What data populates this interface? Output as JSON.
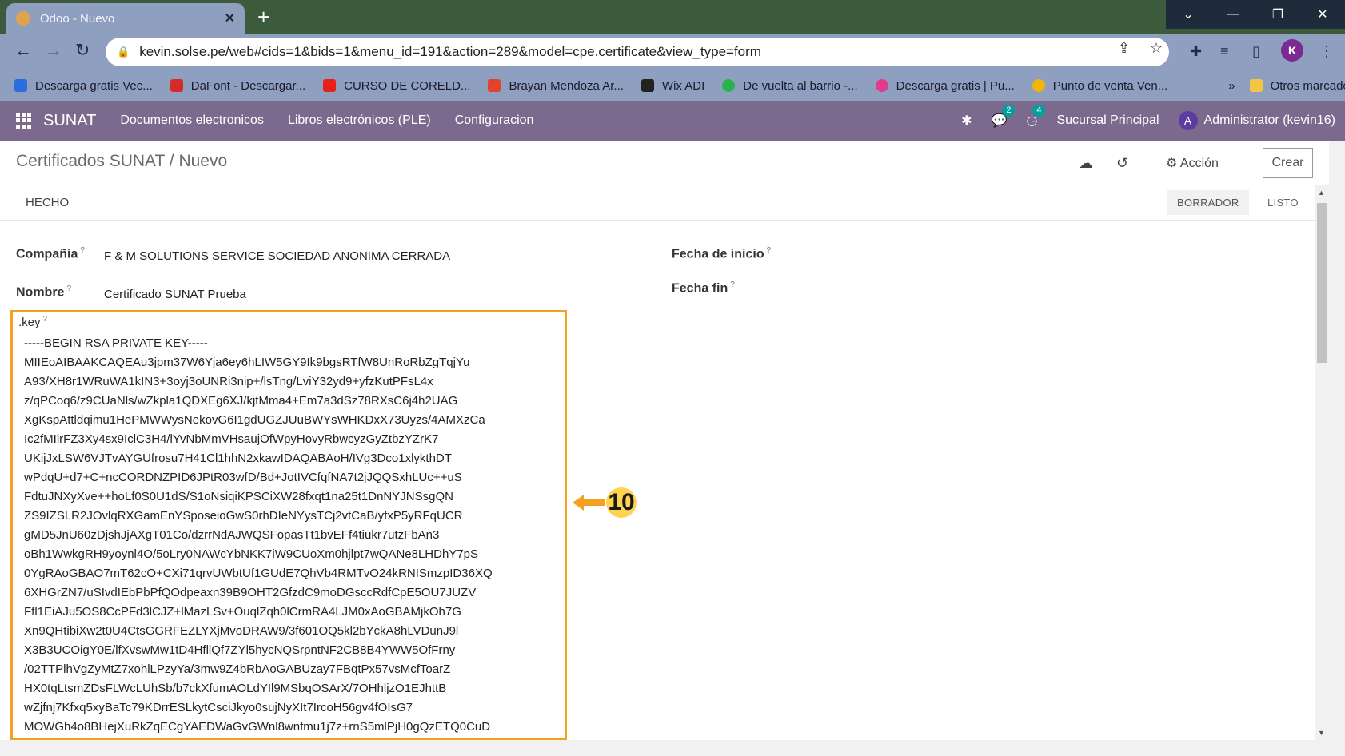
{
  "browser": {
    "tab_title": "Odoo - Nuevo",
    "url": "kevin.solse.pe/web#cids=1&bids=1&menu_id=191&action=289&model=cpe.certificate&view_type=form",
    "profile_initial": "K",
    "bookmarks": [
      {
        "label": "Descarga gratis Vec...",
        "icon": "freepik-icon",
        "color": "#2d6cdf"
      },
      {
        "label": "DaFont - Descargar...",
        "icon": "dafont-icon",
        "color": "#d62b2b"
      },
      {
        "label": "CURSO DE CORELD...",
        "icon": "youtube-icon",
        "color": "#e62117"
      },
      {
        "label": "Brayan Mendoza Ar...",
        "icon": "gitlab-icon",
        "color": "#e2432a"
      },
      {
        "label": "Wix ADI",
        "icon": "wix-icon",
        "color": "#222222"
      },
      {
        "label": "De vuelta al barrio -...",
        "icon": "play-icon",
        "color": "#2bb24c"
      },
      {
        "label": "Descarga gratis | Pu...",
        "icon": "pu-icon",
        "color": "#e23b8c"
      },
      {
        "label": "Punto de venta Ven...",
        "icon": "pos-icon",
        "color": "#f2b705"
      }
    ],
    "bookmarks_more": "»",
    "other_bookmarks": "Otros marcadores"
  },
  "odoo": {
    "brand": "SUNAT",
    "menus": [
      "Documentos electronicos",
      "Libros electrónicos (PLE)",
      "Configuracion"
    ],
    "messages_count": "2",
    "activities_count": "4",
    "branch": "Sucursal Principal",
    "user_initial": "A",
    "user": "Administrator (kevin16)"
  },
  "control_panel": {
    "breadcrumb": "Certificados SUNAT / Nuevo",
    "action_label": "Acción",
    "create_label": "Crear"
  },
  "status": {
    "done_button": "HECHO",
    "stages": [
      "BORRADOR",
      "LISTO"
    ],
    "active_stage": "BORRADOR"
  },
  "form": {
    "company_label": "Compañía",
    "company_value": "F & M SOLUTIONS SERVICE SOCIEDAD ANONIMA CERRADA",
    "name_label": "Nombre",
    "name_value": "Certificado SUNAT Prueba",
    "start_label": "Fecha de inicio",
    "end_label": "Fecha fin",
    "help_mark": "?",
    "key_label": ".key",
    "key_text": "-----BEGIN RSA PRIVATE KEY-----\nMIIEoAIBAAKCAQEAu3jpm37W6Yja6ey6hLIW5GY9Ik9bgsRTfW8UnRoRbZgTqjYu\nA93/XH8r1WRuWA1kIN3+3oyj3oUNRi3nip+/lsTng/LviY32yd9+yfzKutPFsL4x\nz/qPCoq6/z9CUaNls/wZkpla1QDXEg6XJ/kjtMma4+Em7a3dSz78RXsC6j4h2UAG\nXgKspAttldqimu1HePMWWysNekovG6I1gdUGZJUuBWYsWHKDxX73Uyzs/4AMXzCa\nIc2fMIlrFZ3Xy4sx9IclC3H4/lYvNbMmVHsaujOfWpyHovyRbwcyzGyZtbzYZrK7\nUKijJxLSW6VJTvAYGUfrosu7H41Cl1hhN2xkawIDAQABAoH/IVg3Dco1xlykthDT\nwPdqU+d7+C+ncCORDNZPID6JPtR03wfD/Bd+JotIVCfqfNA7t2jJQQSxhLUc++uS\nFdtuJNXyXve++hoLf0S0U1dS/S1oNsiqiKPSCiXW28fxqt1na25t1DnNYJNSsgQN\nZS9IZSLR2JOvlqRXGamEnYSposeioGwS0rhDIeNYysTCj2vtCaB/yfxP5yRFqUCR\ngMD5JnU60zDjshJjAXgT01Co/dzrrNdAJWQSFopasTt1bvEFf4tiukr7utzFbAn3\noBh1WwkgRH9yoynl4O/5oLry0NAWcYbNKK7iW9CUoXm0hjlpt7wQANe8LHDhY7pS\n0YgRAoGBAO7mT62cO+CXi71qrvUWbtUf1GUdE7QhVb4RMTvO24kRNISmzpID36XQ\n6XHGrZN7/uSIvdIEbPbPfQOdpeaxn39B9OHT2GfzdC9moDGsccRdfCpE5OU7JUZV\nFfl1EiAJu5OS8CcPFd3lCJZ+lMazLSv+OuqlZqh0lCrmRA4LJM0xAoGBAMjkOh7G\nXn9QHtibiXw2t0U4CtsGGRFEZLYXjMvoDRAW9/3f601OQ5kl2bYckA8hLVDunJ9l\nX3B3UCOigY0E/lfXvswMw1tD4HfllQf7ZYl5hycNQSrpntNF2CB8B4YWW5OfFrny\n/02TTPlhVgZyMtZ7xohlLPzyYa/3mw9Z4bRbAoGABUzay7FBqtPx57vsMcfToarZ\nHX0tqLtsmZDsFLWcLUhSb/b7ckXfumAOLdYIl9MSbqOSArX/7OHhljzO1EJhttB\nwZjfnj7Kfxq5xyBaTc79KDrrESLkytCsciJkyo0sujNyXIt7IrcoH56gv4fOIsG7\nMOWGh4o8BHejXuRkZqECgYAEDWaGvGWnl8wnfmu1j7z+rnS5mlPjH0gQzETQ0CuD"
  },
  "annotation": {
    "step_number": "10",
    "color": "#f5a023"
  }
}
